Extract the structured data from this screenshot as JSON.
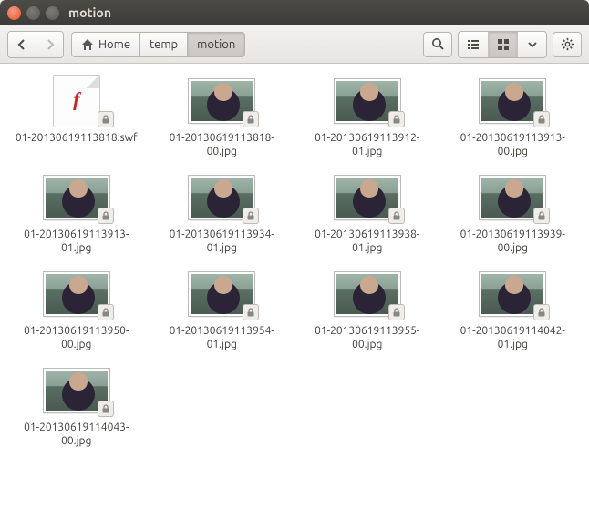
{
  "window": {
    "title": "motion"
  },
  "toolbar": {
    "home_label": "Home",
    "breadcrumbs": [
      "temp",
      "motion"
    ],
    "icons": {
      "back": "back-icon",
      "forward": "forward-icon",
      "home": "home-icon",
      "search": "search-icon",
      "list": "list-view-icon",
      "grid": "grid-view-icon",
      "dropdown": "chevron-down-icon",
      "gear": "gear-icon"
    }
  },
  "files": [
    {
      "name": "01-20130619113818.swf",
      "type": "swf",
      "readonly": true
    },
    {
      "name": "01-20130619113818-00.jpg",
      "type": "jpg",
      "readonly": true
    },
    {
      "name": "01-20130619113912-01.jpg",
      "type": "jpg",
      "readonly": true
    },
    {
      "name": "01-20130619113913-00.jpg",
      "type": "jpg",
      "readonly": true
    },
    {
      "name": "01-20130619113913-01.jpg",
      "type": "jpg",
      "readonly": true
    },
    {
      "name": "01-20130619113934-01.jpg",
      "type": "jpg",
      "readonly": true
    },
    {
      "name": "01-20130619113938-01.jpg",
      "type": "jpg",
      "readonly": true
    },
    {
      "name": "01-20130619113939-00.jpg",
      "type": "jpg",
      "readonly": true
    },
    {
      "name": "01-20130619113950-00.jpg",
      "type": "jpg",
      "readonly": true
    },
    {
      "name": "01-20130619113954-01.jpg",
      "type": "jpg",
      "readonly": true
    },
    {
      "name": "01-20130619113955-00.jpg",
      "type": "jpg",
      "readonly": true
    },
    {
      "name": "01-20130619114042-01.jpg",
      "type": "jpg",
      "readonly": true
    },
    {
      "name": "01-20130619114043-00.jpg",
      "type": "jpg",
      "readonly": true
    }
  ]
}
